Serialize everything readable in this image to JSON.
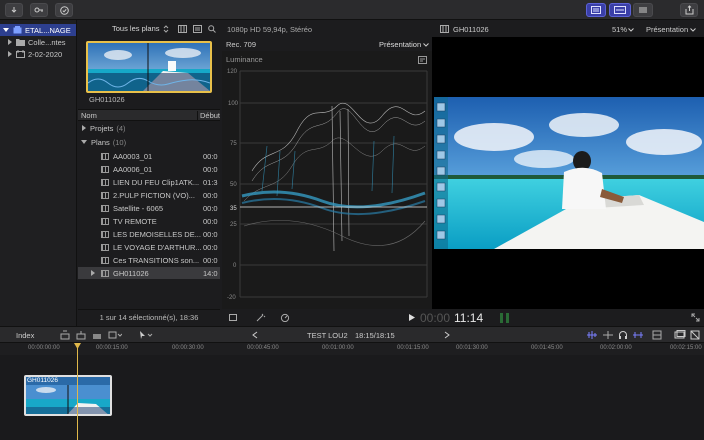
{
  "toolbar": {
    "left_icons": [
      "import-icon",
      "keywords-icon",
      "checkmark-icon"
    ],
    "right_icons": [
      "browser-toggle-icon",
      "timeline-toggle-icon",
      "inspector-toggle-icon",
      "share-icon"
    ]
  },
  "library": {
    "items": [
      {
        "label": "ETAL...NAGE",
        "selected": true
      },
      {
        "label": "Colle...ntes",
        "selected": false
      },
      {
        "label": "2-02-2020",
        "selected": false
      }
    ]
  },
  "browser": {
    "filter_label": "Tous les plans",
    "thumb_label": "GH011026",
    "columns": {
      "name": "Nom",
      "start": "Début"
    },
    "groups": [
      {
        "label": "Projets",
        "count": "(4)"
      },
      {
        "label": "Plans",
        "count": "(10)"
      }
    ],
    "clips": [
      {
        "name": "AA0003_01",
        "tc": "00:0"
      },
      {
        "name": "AA0006_01",
        "tc": "00:0"
      },
      {
        "name": "LIEN DU FEU  Clip1ATK...",
        "tc": "01:3"
      },
      {
        "name": "2.PULP FICTION (VO)...",
        "tc": "00:0"
      },
      {
        "name": "Satellite - 6065",
        "tc": "00:0"
      },
      {
        "name": "TV REMOTE",
        "tc": "00:0"
      },
      {
        "name": "LES DEMOISELLES DE...",
        "tc": "00:0"
      },
      {
        "name": "LE VOYAGE D'ARTHUR...",
        "tc": "00:0"
      },
      {
        "name": "Ces TRANSITIONS son...",
        "tc": "00:0"
      },
      {
        "name": "GH011026",
        "tc": "14:0"
      }
    ],
    "status": "1 sur 14 sélectionné(s), 18:36"
  },
  "scope": {
    "format": "1080p HD 59,94p, Stéréo",
    "standard": "Rec. 709",
    "presentation": "Présentation",
    "mode": "Luminance",
    "scale": [
      "120",
      "100",
      "75",
      "50",
      "35",
      "25",
      "0",
      "-20"
    ]
  },
  "viewer": {
    "clip_name": "GH011026",
    "zoom": "51%",
    "presentation": "Présentation",
    "timecode_dim": "00:00",
    "timecode": "11:14"
  },
  "timeline": {
    "index_label": "Index",
    "project_name": "TEST LOU2",
    "duration": "18:15/18:15",
    "ruler": [
      "00:00:00:00",
      "00:00:15:00",
      "00:00:30:00",
      "00:00:45:00",
      "00:01:00:00",
      "00:01:15:00",
      "00:01:30:00",
      "00:01:45:00",
      "00:02:00:00",
      "00:02:15:00"
    ],
    "clip_label": "GH011026"
  },
  "colors": {
    "accent": "#5c62d6",
    "selection": "#2d3f8f",
    "playhead": "#e0b84a",
    "scope_trace": "#3ab0e0"
  }
}
